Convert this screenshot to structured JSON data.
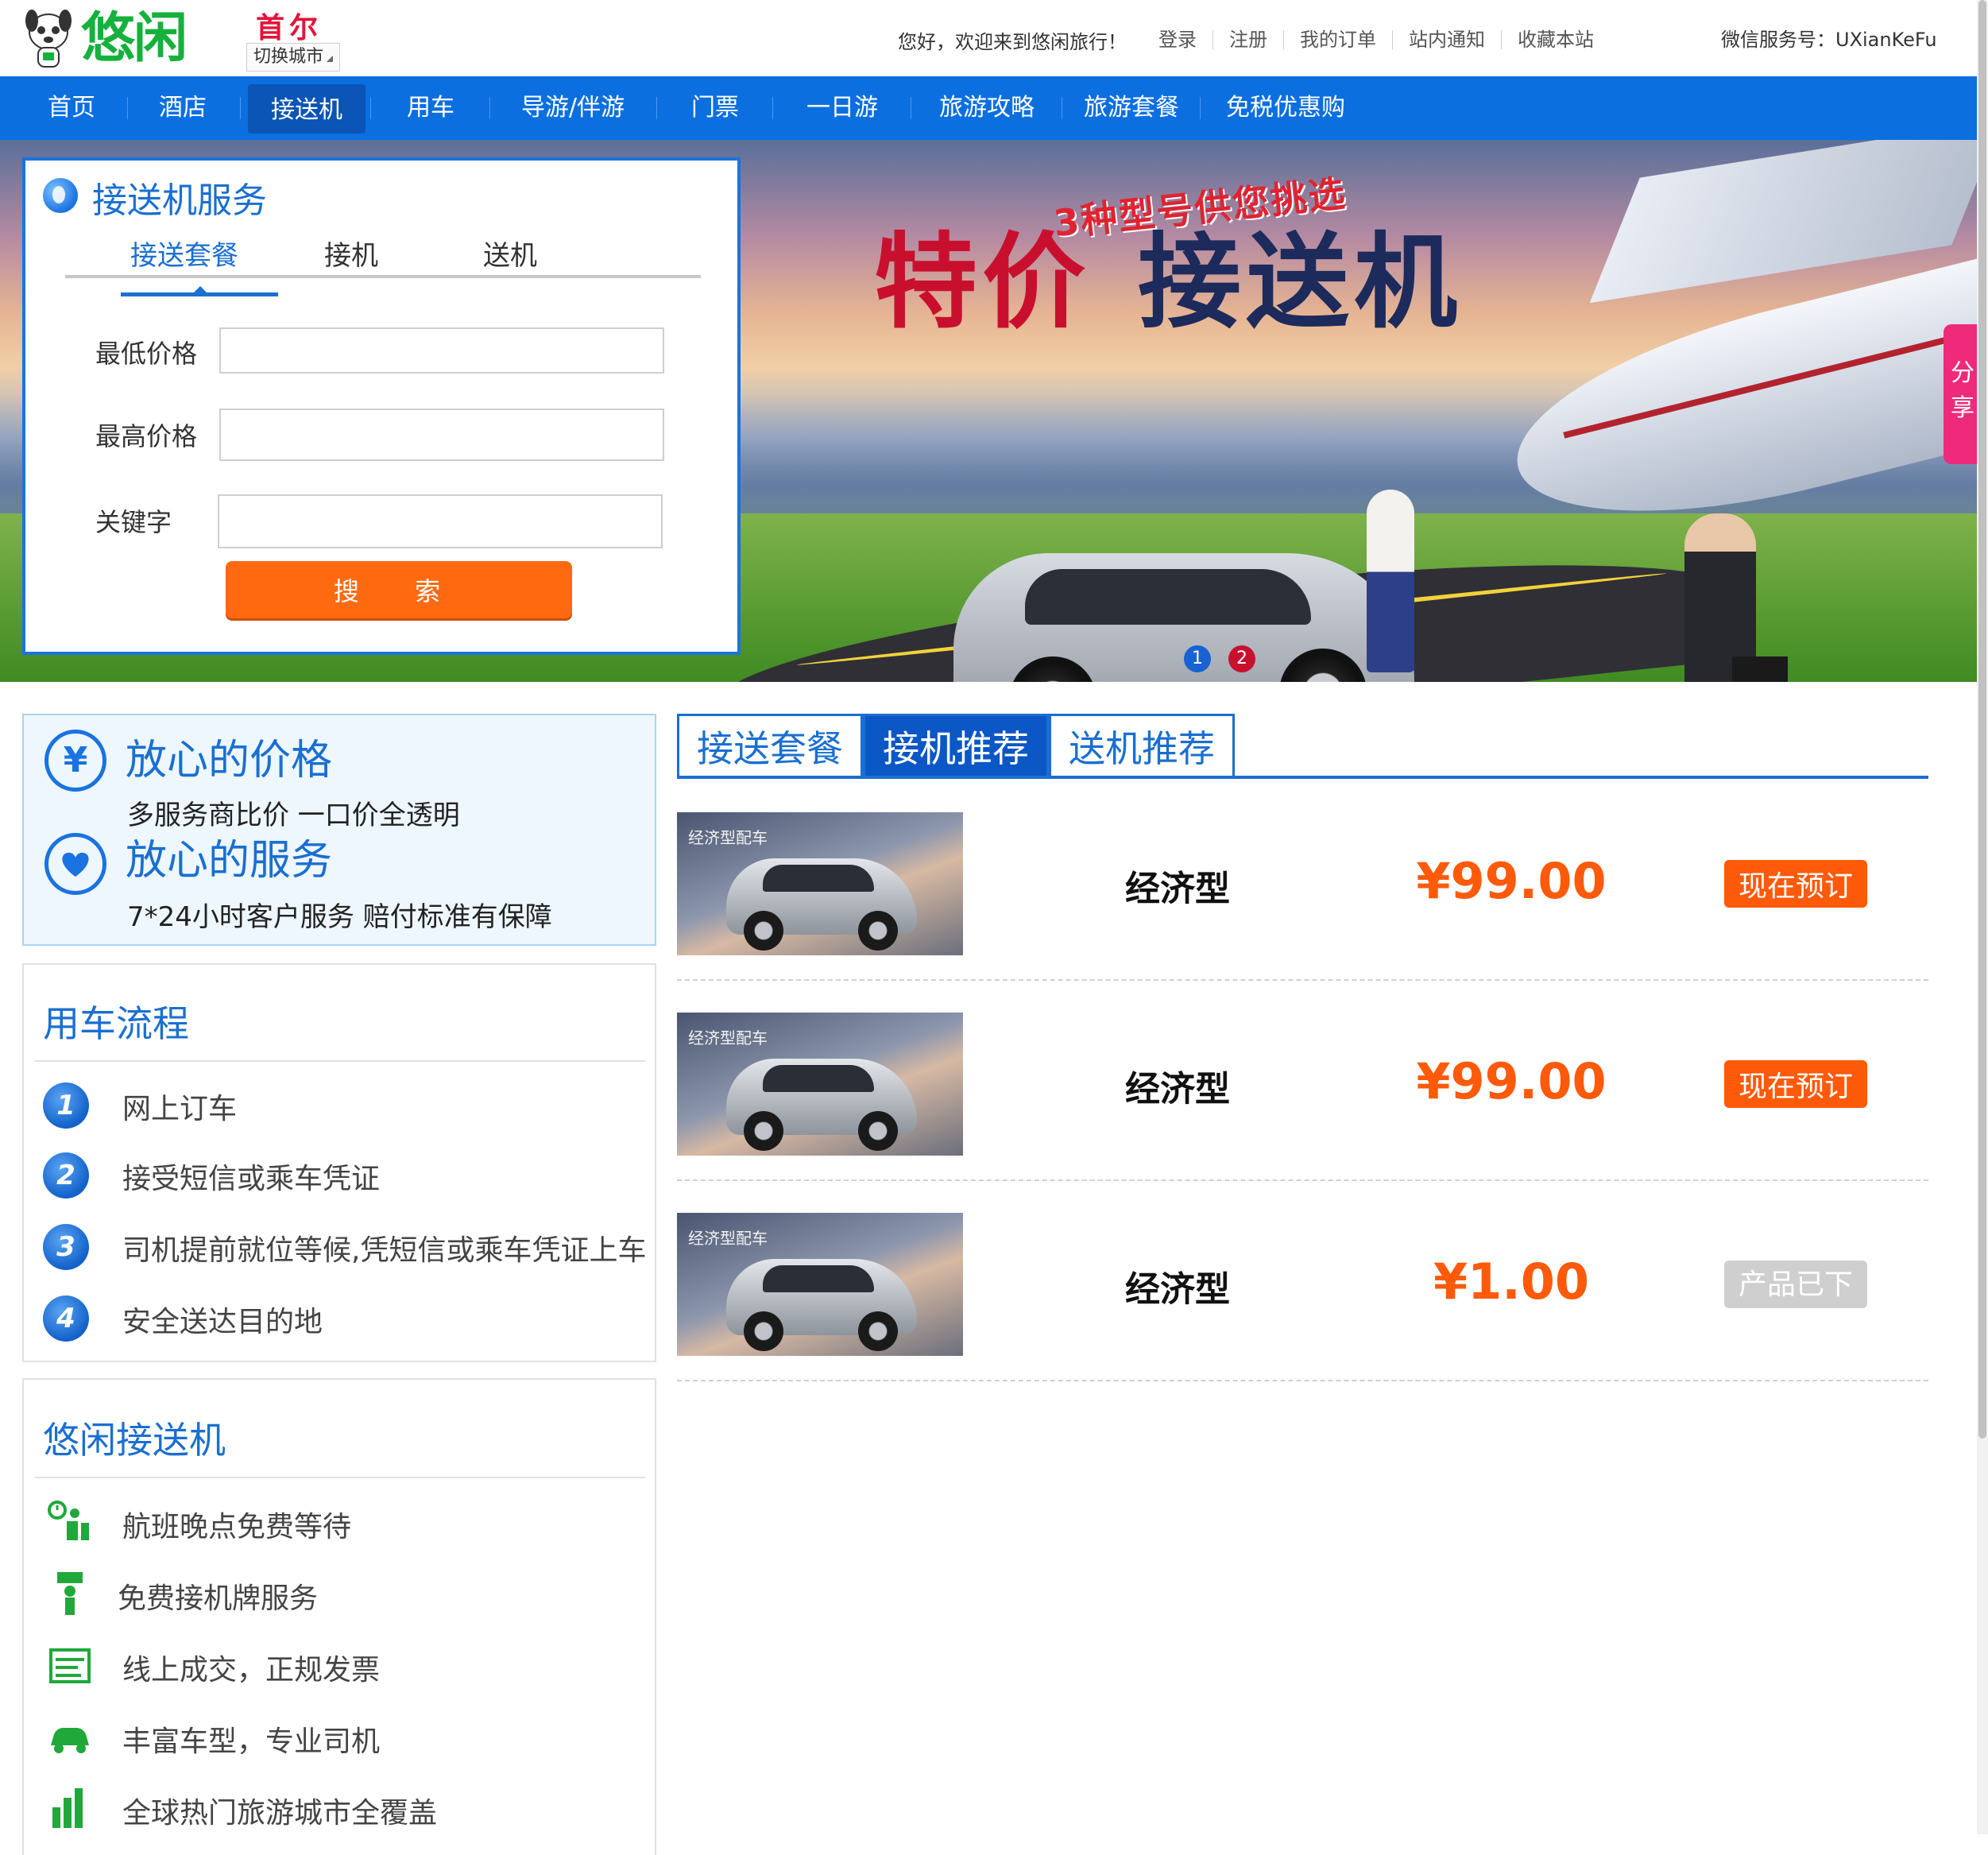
{
  "header": {
    "brand": "悠闲",
    "city_name": "首尔",
    "city_switch": "切换城市",
    "welcome": "您好，欢迎来到悠闲旅行！",
    "links": [
      "登录",
      "注册",
      "我的订单",
      "站内通知",
      "收藏本站"
    ],
    "wechat": "微信服务号：UXianKeFu"
  },
  "nav": {
    "items": [
      "首页",
      "酒店",
      "接送机",
      "用车",
      "导游/伴游",
      "门票",
      "一日游",
      "旅游攻略",
      "旅游套餐",
      "免税优惠购"
    ],
    "active_index": 2
  },
  "banner": {
    "slogan_small": "3种型号供您挑选",
    "slogan_red": "特价",
    "slogan_navy": "接送机",
    "dots": [
      "1",
      "2"
    ]
  },
  "share": {
    "label_1": "分",
    "label_2": "享"
  },
  "search": {
    "title": "接送机服务",
    "tabs": [
      "接送套餐",
      "接机",
      "送机"
    ],
    "active_tab": 0,
    "fields": [
      {
        "label": "最低价格",
        "value": "",
        "placeholder": ""
      },
      {
        "label": "最高价格",
        "value": "",
        "placeholder": ""
      },
      {
        "label": "关键字",
        "value": "",
        "placeholder": ""
      }
    ],
    "button": "搜 索"
  },
  "assurance": {
    "items": [
      {
        "icon": "yen-icon",
        "title": "放心的价格",
        "desc": "多服务商比价  一口价全透明"
      },
      {
        "icon": "heart-icon",
        "title": "放心的服务",
        "desc": "7*24小时客户服务  赔付标准有保障"
      }
    ]
  },
  "process": {
    "title": "用车流程",
    "steps": [
      "网上订车",
      "接受短信或乘车凭证",
      "司机提前就位等候,凭短信或乘车凭证上车",
      "安全送达目的地"
    ]
  },
  "features": {
    "title": "悠闲接送机",
    "items": [
      {
        "icon": "waiting-clock-icon",
        "text": "航班晚点免费等待"
      },
      {
        "icon": "pickup-sign-icon",
        "text": "免费接机牌服务"
      },
      {
        "icon": "invoice-icon",
        "text": "线上成交，正规发票"
      },
      {
        "icon": "car-icon",
        "text": "丰富车型，专业司机"
      },
      {
        "icon": "city-chart-icon",
        "text": "全球热门旅游城市全覆盖"
      }
    ]
  },
  "products": {
    "tabs": [
      "接送套餐",
      "接机推荐",
      "送机推荐"
    ],
    "active_tab": 1,
    "rows": [
      {
        "image_tag": "经济型配车",
        "type": "经济型",
        "price": "¥99.00",
        "action": "现在预订",
        "available": true
      },
      {
        "image_tag": "经济型配车",
        "type": "经济型",
        "price": "¥99.00",
        "action": "现在预订",
        "available": true
      },
      {
        "image_tag": "经济型配车",
        "type": "经济型",
        "price": "¥1.00",
        "action": "产品已下架",
        "available": false
      }
    ]
  },
  "colors": {
    "brand_green": "#15b13c",
    "nav_blue": "#0b6fe0",
    "accent_orange": "#ff5a0a",
    "link_blue": "#1a6fd1"
  }
}
